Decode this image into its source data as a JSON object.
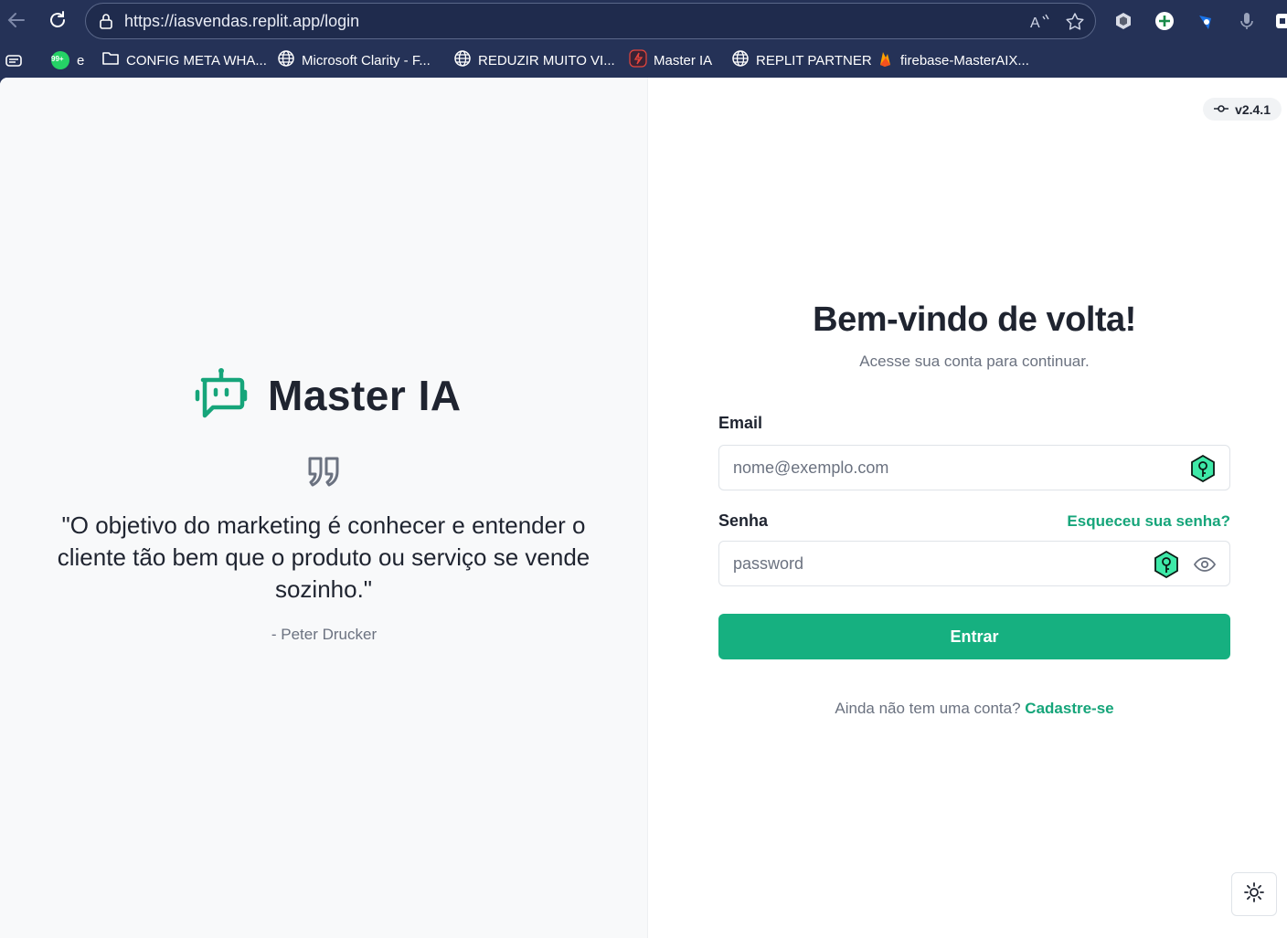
{
  "browser": {
    "url": "https://iasvendas.replit.app/login",
    "bookmarks": [
      {
        "label": "e",
        "icon": "whatsapp-badge-icon"
      },
      {
        "label": "CONFIG META WHA...",
        "icon": "folder-icon"
      },
      {
        "label": "Microsoft Clarity - F...",
        "icon": "globe-icon"
      },
      {
        "label": "REDUZIR MUITO VI...",
        "icon": "globe-icon"
      },
      {
        "label": "Master IA",
        "icon": "replit-icon"
      },
      {
        "label": "REPLIT PARTNER",
        "icon": "globe-icon"
      },
      {
        "label": "firebase-MasterAIX...",
        "icon": "firebase-icon"
      }
    ],
    "whatsapp_badge": "99+"
  },
  "version": "v2.4.1",
  "brand": {
    "name": "Master IA",
    "accent": "#16b080"
  },
  "quote": {
    "text": "\"O objetivo do marketing é conhecer e entender o cliente tão bem que o produto ou serviço se vende sozinho.\"",
    "author": "- Peter Drucker"
  },
  "login": {
    "title": "Bem-vindo de volta!",
    "subtitle": "Acesse sua conta para continuar.",
    "email_label": "Email",
    "email_placeholder": "nome@exemplo.com",
    "password_label": "Senha",
    "password_placeholder": "password",
    "forgot_label": "Esqueceu sua senha?",
    "submit_label": "Entrar",
    "signup_prompt": "Ainda não tem uma conta?",
    "signup_link": "Cadastre-se"
  }
}
